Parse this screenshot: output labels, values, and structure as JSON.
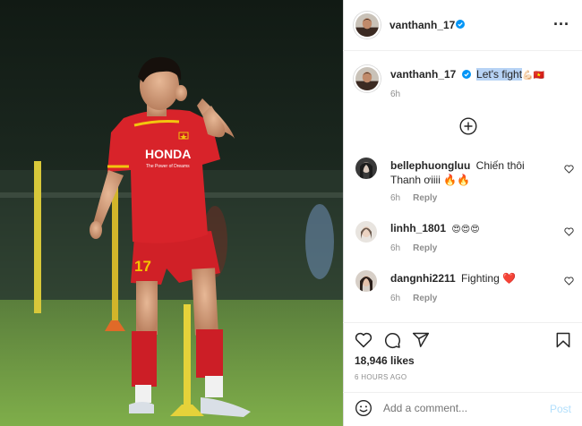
{
  "post": {
    "username": "vanthanh_17",
    "caption_text": "Let's fight",
    "caption_emoji": "💪🏻🇻🇳",
    "caption_time": "6h",
    "likes": "18,946 likes",
    "posted_ago": "6 HOURS AGO"
  },
  "jersey": {
    "sponsor": "HONDA",
    "slogan": "The Power of Dreams",
    "number": "17"
  },
  "comments": [
    {
      "username": "bellephuongluu",
      "text": "Chiến thôi Thanh ơiiii 🔥🔥",
      "time": "6h",
      "reply": "Reply"
    },
    {
      "username": "linhh_1801",
      "text": "😍😍😍",
      "time": "6h",
      "reply": "Reply"
    },
    {
      "username": "dangnhi2211",
      "text": "Fighting ❤️",
      "time": "6h",
      "reply": "Reply"
    }
  ],
  "composer": {
    "placeholder": "Add a comment...",
    "post_label": "Post"
  },
  "colors": {
    "verified": "#0095f6",
    "jersey_red": "#d8232a",
    "post_button_disabled": "#b2dffc"
  },
  "icons": [
    "more-options-icon",
    "verified-badge-icon",
    "load-more-comments-icon",
    "heart-icon",
    "comment-icon",
    "share-icon",
    "bookmark-icon",
    "emoji-icon"
  ]
}
